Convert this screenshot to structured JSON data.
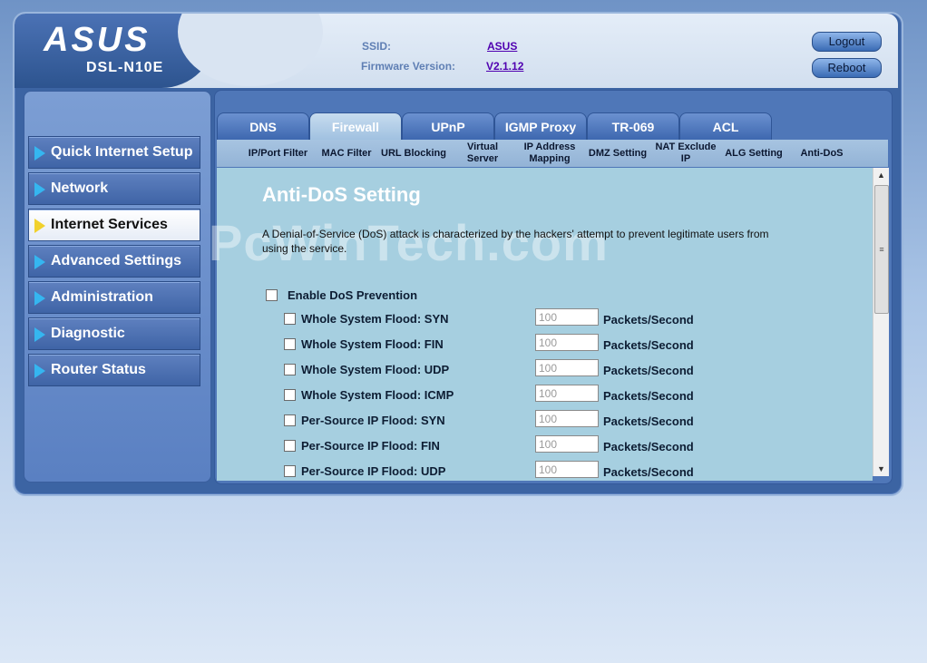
{
  "header": {
    "logo": "ASUS",
    "model": "DSL-N10E",
    "ssid_label": "SSID:",
    "ssid_value": "ASUS",
    "firmware_label": "Firmware Version:",
    "firmware_value": "V2.1.12",
    "logout_label": "Logout",
    "reboot_label": "Reboot"
  },
  "sidebar": {
    "items": [
      {
        "label": "Quick Internet Setup",
        "active": false
      },
      {
        "label": "Network",
        "active": false
      },
      {
        "label": "Internet Services",
        "active": true
      },
      {
        "label": "Advanced Settings",
        "active": false
      },
      {
        "label": "Administration",
        "active": false
      },
      {
        "label": "Diagnostic",
        "active": false
      },
      {
        "label": "Router Status",
        "active": false
      }
    ]
  },
  "tabs": [
    {
      "label": "DNS",
      "active": false
    },
    {
      "label": "Firewall",
      "active": true
    },
    {
      "label": "UPnP",
      "active": false
    },
    {
      "label": "IGMP Proxy",
      "active": false
    },
    {
      "label": "TR-069",
      "active": false
    },
    {
      "label": "ACL",
      "active": false
    }
  ],
  "subtabs": [
    {
      "label": "IP/Port Filter"
    },
    {
      "label": "MAC Filter"
    },
    {
      "label": "URL Blocking"
    },
    {
      "label": "Virtual Server"
    },
    {
      "label": "IP Address Mapping"
    },
    {
      "label": "DMZ Setting"
    },
    {
      "label": "NAT Exclude IP"
    },
    {
      "label": "ALG Setting"
    },
    {
      "label": "Anti-DoS"
    }
  ],
  "main": {
    "watermark": "PcWinTech.com",
    "title": "Anti-DoS Setting",
    "description": "A Denial-of-Service (DoS) attack is characterized by the hackers' attempt to prevent legitimate users from using the service.",
    "enable_label": "Enable DoS Prevention",
    "unit": "Packets/Second",
    "rows": [
      {
        "label": "Whole System Flood: SYN",
        "value": "100"
      },
      {
        "label": "Whole System Flood: FIN",
        "value": "100"
      },
      {
        "label": "Whole System Flood: UDP",
        "value": "100"
      },
      {
        "label": "Whole System Flood: ICMP",
        "value": "100"
      },
      {
        "label": "Per-Source IP Flood: SYN",
        "value": "100"
      },
      {
        "label": "Per-Source IP Flood: FIN",
        "value": "100"
      },
      {
        "label": "Per-Source IP Flood: UDP",
        "value": "100"
      }
    ]
  },
  "icons": {
    "menu_arrow": "triangle-right-icon",
    "scroll_up": "triangle-up-icon",
    "scroll_down": "triangle-down-icon"
  },
  "colors": {
    "accent_arrow": "#35b6f0",
    "active_arrow": "#f1d12c",
    "panel_bg": "#a6cfe0",
    "link_color": "#5000b0"
  }
}
